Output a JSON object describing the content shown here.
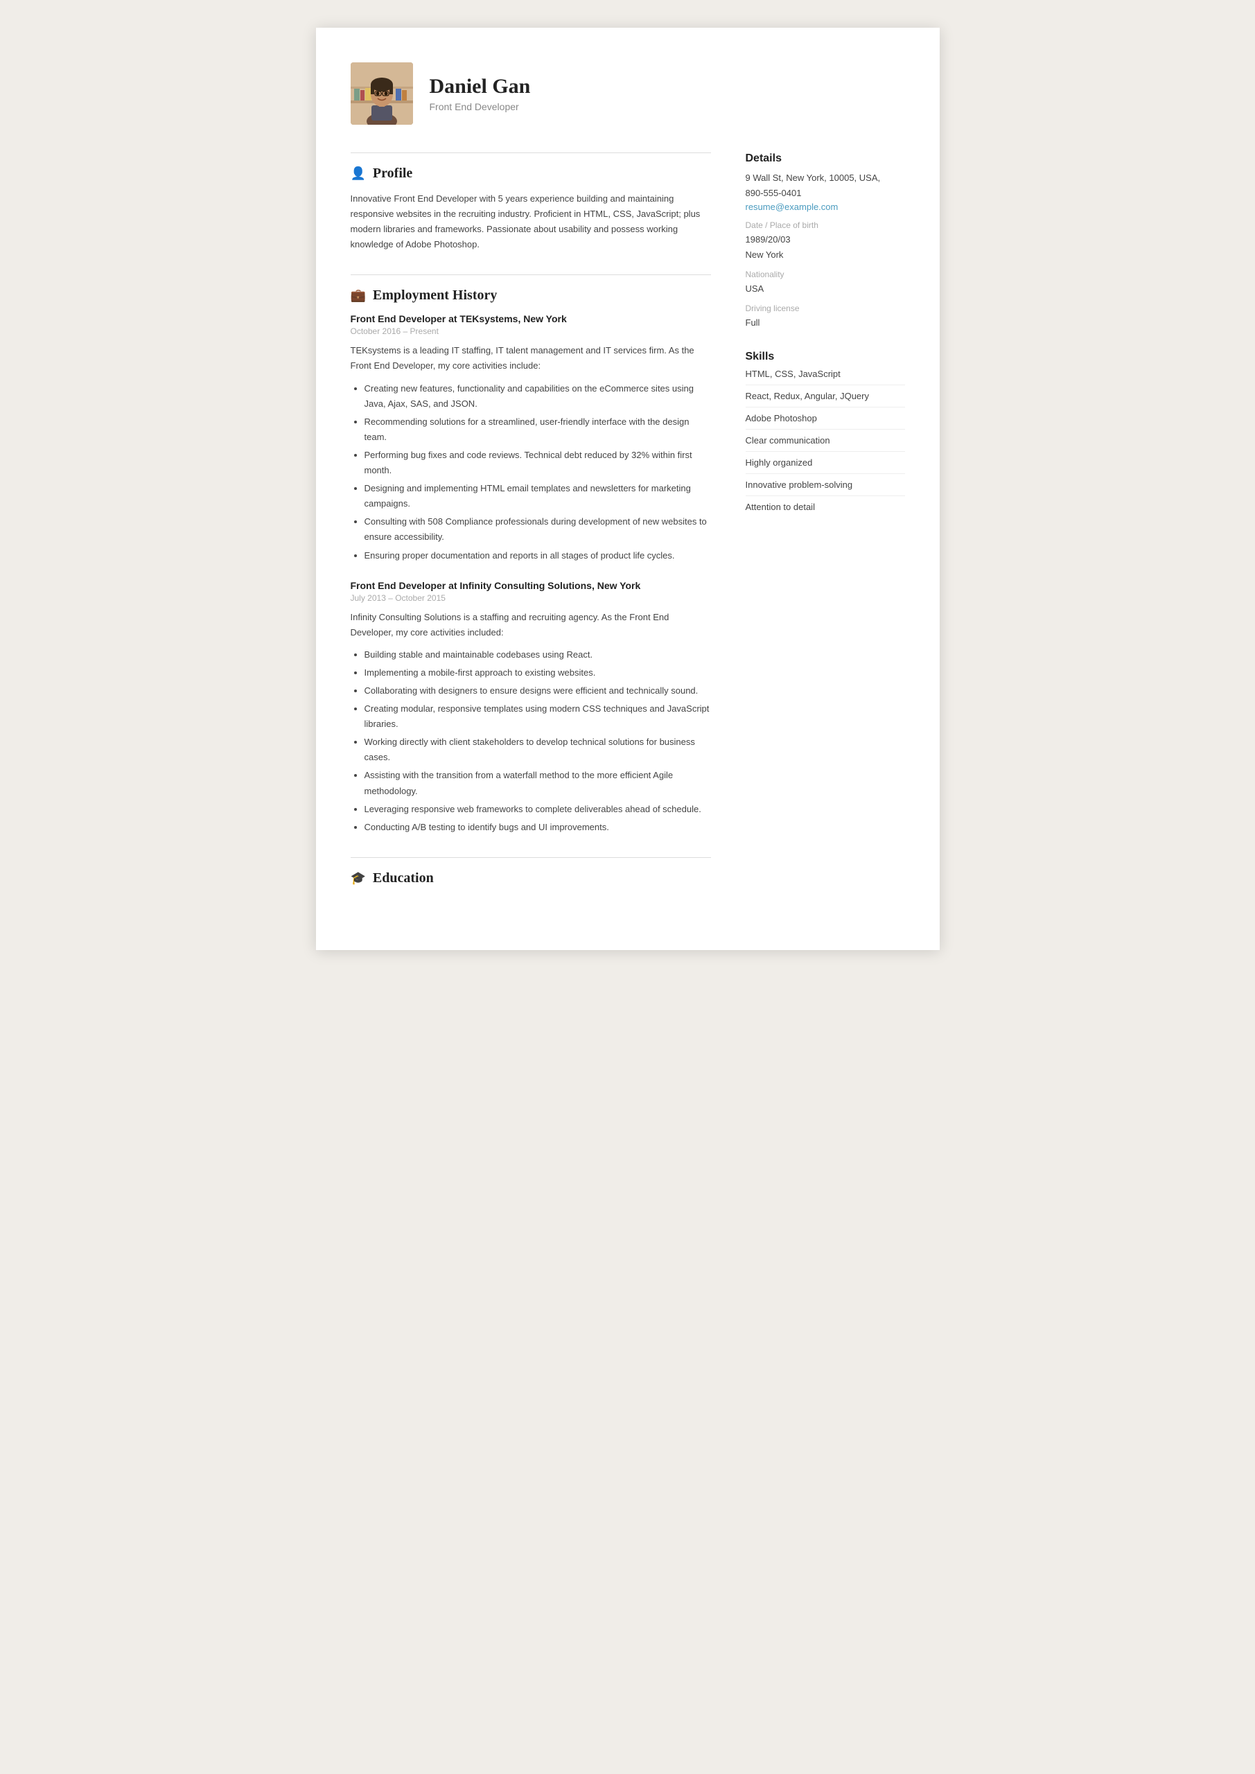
{
  "header": {
    "name": "Daniel Gan",
    "subtitle": "Front End Developer"
  },
  "profile": {
    "section_title": "Profile",
    "icon": "👤",
    "text": "Innovative Front End Developer with 5 years experience building and maintaining responsive websites in the recruiting industry. Proficient in HTML, CSS, JavaScript; plus modern libraries and frameworks. Passionate about usability and possess working knowledge of Adobe Photoshop."
  },
  "employment": {
    "section_title": "Employment History",
    "icon": "💼",
    "jobs": [
      {
        "title": "Front End Developer at TEKsystems, New York",
        "dates": "October 2016  –  Present",
        "description": "TEKsystems is a leading IT staffing, IT talent management and IT services firm. As the Front End Developer, my core activities include:",
        "bullets": [
          "Creating new features, functionality and capabilities on the eCommerce sites using Java, Ajax, SAS, and JSON.",
          "Recommending solutions for a streamlined, user-friendly interface with the design team.",
          "Performing bug fixes and code reviews. Technical debt reduced by 32% within first month.",
          "Designing and implementing HTML email templates and newsletters for marketing campaigns.",
          "Consulting with 508 Compliance professionals during development of new websites to ensure accessibility.",
          "Ensuring proper documentation and reports in all stages of product life cycles."
        ]
      },
      {
        "title": "Front End Developer at Infinity Consulting Solutions, New York",
        "dates": "July 2013  –  October 2015",
        "description": "Infinity Consulting Solutions is a staffing and recruiting agency. As the Front End Developer, my core activities included:",
        "bullets": [
          "Building stable and maintainable codebases using React.",
          "Implementing a mobile-first approach to existing websites.",
          "Collaborating with designers to ensure designs were efficient and technically sound.",
          "Creating modular, responsive templates using modern CSS techniques and JavaScript libraries.",
          "Working directly with client stakeholders to develop technical solutions for business cases.",
          "Assisting with the transition from a waterfall method to the more efficient Agile methodology.",
          "Leveraging responsive web frameworks to complete deliverables ahead of schedule.",
          "Conducting A/B testing to identify bugs and UI improvements."
        ]
      }
    ]
  },
  "education": {
    "section_title": "Education",
    "icon": "🎓"
  },
  "details": {
    "section_title": "Details",
    "address": "9 Wall St, New York, 10005, USA,",
    "phone": "890-555-0401",
    "email": "resume@example.com",
    "dob_label": "Date / Place of birth",
    "dob": "1989/20/03",
    "birth_place": "New York",
    "nationality_label": "Nationality",
    "nationality": "USA",
    "driving_label": "Driving license",
    "driving": "Full"
  },
  "skills": {
    "section_title": "Skills",
    "items": [
      "HTML, CSS, JavaScript",
      "React, Redux, Angular, JQuery",
      "Adobe Photoshop",
      "Clear communication",
      "Highly organized",
      "Innovative problem-solving",
      "Attention to detail"
    ]
  }
}
